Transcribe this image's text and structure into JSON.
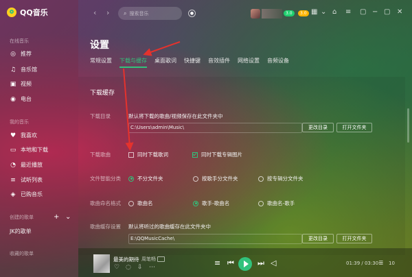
{
  "app": {
    "name": "QQ音乐",
    "brand_color": "#31c27c",
    "arrow_color": "#e5322d"
  },
  "sidebar": {
    "online_title": "在线音乐",
    "online_items": [
      {
        "icon": "disc-icon",
        "label": "推荐"
      },
      {
        "icon": "music-note-icon",
        "label": "音乐馆"
      },
      {
        "icon": "video-icon",
        "label": "视频"
      },
      {
        "icon": "radio-icon",
        "label": "电台"
      }
    ],
    "mine_title": "我的音乐",
    "mine_items": [
      {
        "icon": "heart-icon",
        "label": "我喜欢"
      },
      {
        "icon": "computer-icon",
        "label": "本地和下载"
      },
      {
        "icon": "clock-icon",
        "label": "最近播放"
      },
      {
        "icon": "playlist-icon",
        "label": "试听列表"
      },
      {
        "icon": "purchased-icon",
        "label": "已购音乐"
      }
    ],
    "created_title": "创建的歌单",
    "created_items": [
      "JK的歌单"
    ],
    "collected_title": "收藏的歌单"
  },
  "topbar": {
    "search_placeholder": "搜索音乐",
    "vip_badge": "3.0",
    "vip_badge2": "3.0"
  },
  "settings": {
    "title": "设置",
    "tabs": [
      "常规设置",
      "下载与缓存",
      "桌面歌词",
      "快捷键",
      "音效插件",
      "网络设置",
      "音频设备"
    ],
    "active_tab": 1,
    "section_title": "下载缓存",
    "download_dir": {
      "label": "下载目录",
      "desc": "默认将下载的歌曲/视频保存在此文件夹中",
      "path": "C:\\Users\\admin\\Music\\",
      "change_btn": "更改目录",
      "open_btn": "打开文件夹"
    },
    "download_song": {
      "label": "下载歌曲",
      "opt1": "同时下载歌词",
      "opt1_checked": false,
      "opt2": "同时下载专辑图片",
      "opt2_checked": true
    },
    "smart_classify": {
      "label": "文件智能分类",
      "options": [
        "不分文件夹",
        "按歌手分文件夹",
        "按专辑分文件夹"
      ],
      "selected": 0
    },
    "naming": {
      "label": "歌曲命名格式",
      "options": [
        "歌曲名",
        "歌手-歌曲名",
        "歌曲名-歌手"
      ],
      "selected": 1
    },
    "cache": {
      "label": "歌曲缓存设置",
      "desc": "默认将听过的歌曲缓存在此文件夹中",
      "path": "E:\\QQMusicCache\\",
      "change_btn": "更改目录",
      "open_btn": "打开文件夹"
    }
  },
  "player": {
    "song": "最美的期待",
    "singer": "周笔畅",
    "time": "01:39 / 03:30",
    "playlist_count": "10"
  }
}
